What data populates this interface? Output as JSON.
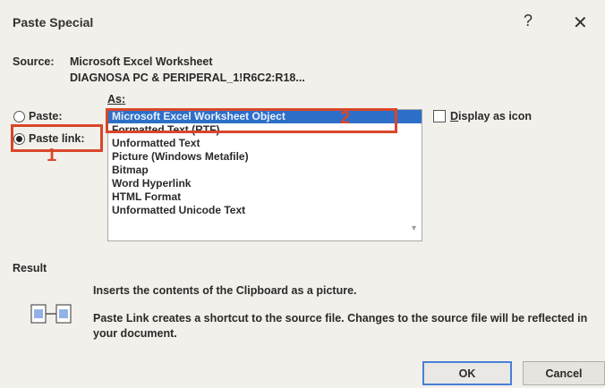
{
  "dialog": {
    "title": "Paste Special",
    "help": "?",
    "close": "✕"
  },
  "source": {
    "label": "Source:",
    "line1": "Microsoft Excel Worksheet",
    "line2": "DIAGNOSA PC & PERIPERAL_1!R6C2:R18..."
  },
  "as_label": "As:",
  "options": {
    "paste": "Paste:",
    "paste_link": "Paste link:",
    "selected": "paste_link"
  },
  "list_items": [
    "Microsoft Excel Worksheet Object",
    "Formatted Text (RTF)",
    "Unformatted Text",
    "Picture (Windows Metafile)",
    "Bitmap",
    "Word Hyperlink",
    "HTML Format",
    "Unformatted Unicode Text"
  ],
  "selected_index": 0,
  "display_as_icon": {
    "label_first": "D",
    "label_rest": "isplay as icon",
    "checked": false
  },
  "result": {
    "label": "Result",
    "text1": "Inserts the contents of the Clipboard as a picture.",
    "text2": "Paste Link creates a shortcut to the source file. Changes to the source file will be reflected in your document."
  },
  "callouts": {
    "one": "1",
    "two": "2"
  },
  "buttons": {
    "ok": "OK",
    "cancel": "Cancel"
  },
  "colors": {
    "selection": "#2d6fc8",
    "callout": "#d9462a",
    "default_button_border": "#4a7fd6"
  }
}
